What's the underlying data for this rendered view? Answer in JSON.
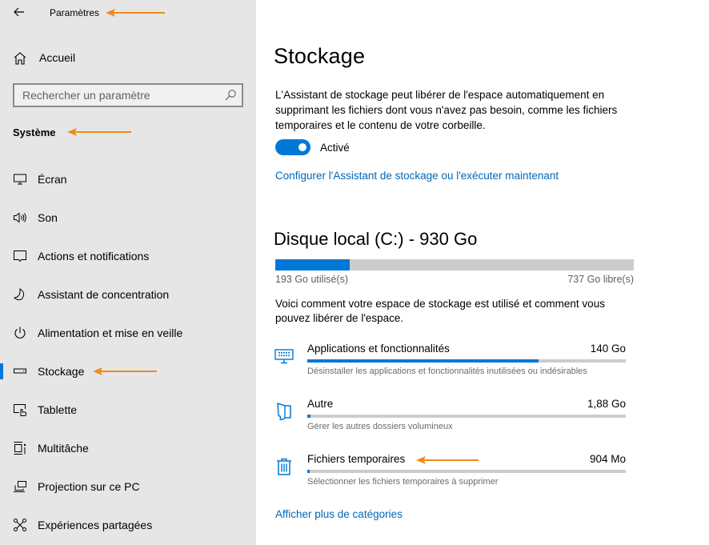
{
  "header": {
    "app_title": "Paramètres",
    "back_icon": "arrow-left-icon"
  },
  "sidebar": {
    "home": {
      "label": "Accueil",
      "icon": "home-icon"
    },
    "search": {
      "placeholder": "Rechercher un paramètre",
      "value": "",
      "icon": "search-icon"
    },
    "section_title": "Système",
    "items": [
      {
        "label": "Écran",
        "icon": "monitor-icon",
        "active": false
      },
      {
        "label": "Son",
        "icon": "speaker-icon",
        "active": false
      },
      {
        "label": "Actions et notifications",
        "icon": "notification-icon",
        "active": false
      },
      {
        "label": "Assistant de concentration",
        "icon": "moon-icon",
        "active": false
      },
      {
        "label": "Alimentation et mise en veille",
        "icon": "power-icon",
        "active": false
      },
      {
        "label": "Stockage",
        "icon": "drive-icon",
        "active": true
      },
      {
        "label": "Tablette",
        "icon": "tablet-icon",
        "active": false
      },
      {
        "label": "Multitâche",
        "icon": "multitask-icon",
        "active": false
      },
      {
        "label": "Projection sur ce PC",
        "icon": "projection-icon",
        "active": false
      },
      {
        "label": "Expériences partagées",
        "icon": "shared-icon",
        "active": false
      }
    ]
  },
  "main": {
    "title": "Stockage",
    "description": "L'Assistant de stockage peut libérer de l'espace automatiquement en supprimant les fichiers dont vous n'avez pas besoin, comme les fichiers temporaires et le contenu de votre corbeille.",
    "toggle": {
      "state": true,
      "label": "Activé"
    },
    "configure_link": "Configurer l'Assistant de stockage ou l'exécuter maintenant",
    "disk": {
      "title": "Disque local (C:) - 930 Go",
      "used_label": "193 Go utilisé(s)",
      "free_label": "737 Go libre(s)",
      "used_fraction": 0.2075
    },
    "usage_description": "Voici comment votre espace de stockage est utilisé et comment vous pouvez libérer de l'espace.",
    "categories": [
      {
        "name": "Applications et fonctionnalités",
        "size": "140 Go",
        "fraction": 0.725,
        "subtitle": "Désinstaller les applications et fonctionnalités inutilisées ou indésirables",
        "icon": "apps-icon"
      },
      {
        "name": "Autre",
        "size": "1,88 Go",
        "fraction": 0.01,
        "subtitle": "Gérer les autres dossiers volumineux",
        "icon": "folder-icon"
      },
      {
        "name": "Fichiers temporaires",
        "size": "904 Mo",
        "fraction": 0.005,
        "subtitle": "Sélectionner les fichiers temporaires à supprimer",
        "icon": "trash-icon"
      }
    ],
    "more_link": "Afficher plus de catégories"
  },
  "colors": {
    "accent": "#0078d7",
    "link": "#0067b8",
    "annotation_arrow": "#f08a1c",
    "sidebar_bg": "#e6e6e6"
  }
}
